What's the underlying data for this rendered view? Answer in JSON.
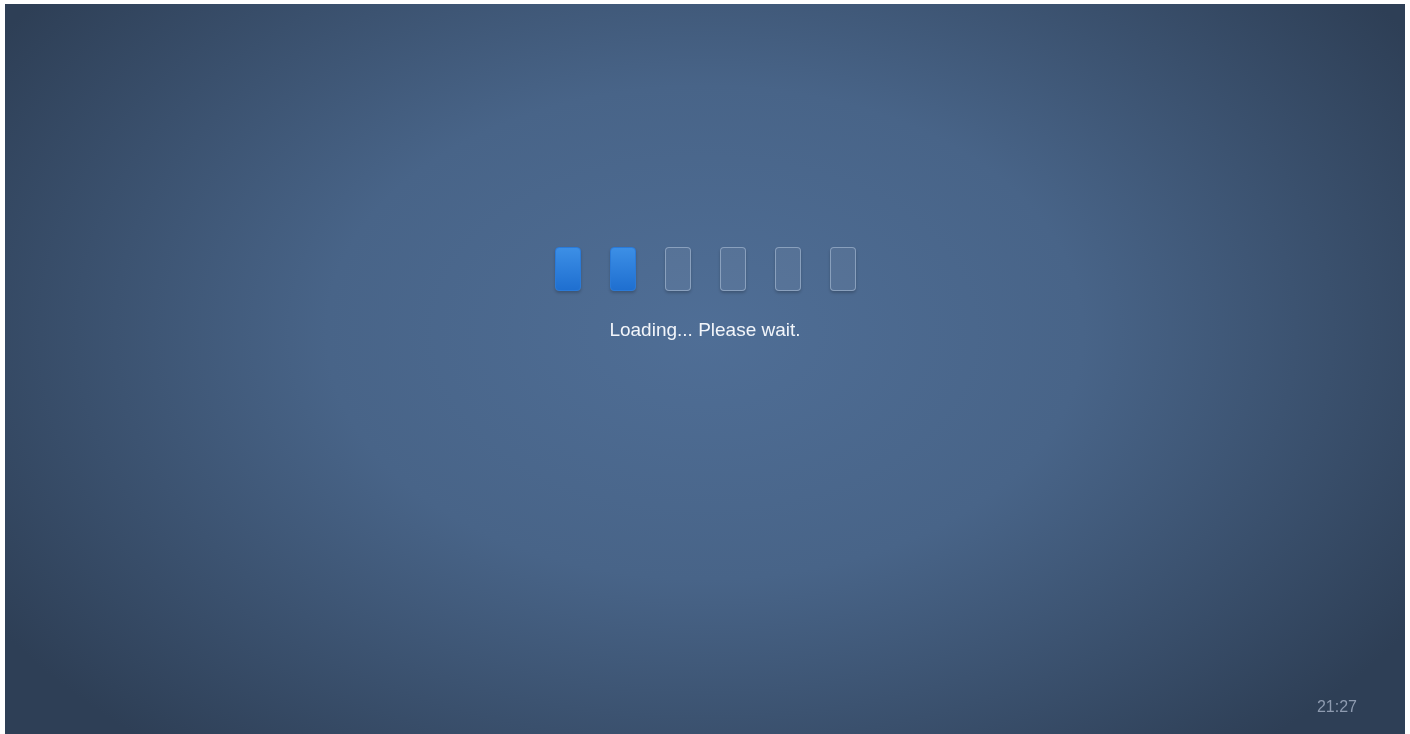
{
  "loader": {
    "segments": [
      {
        "on": true
      },
      {
        "on": true
      },
      {
        "on": false
      },
      {
        "on": false
      },
      {
        "on": false
      },
      {
        "on": false
      }
    ]
  },
  "message": "Loading... Please wait.",
  "clock": "21:27"
}
